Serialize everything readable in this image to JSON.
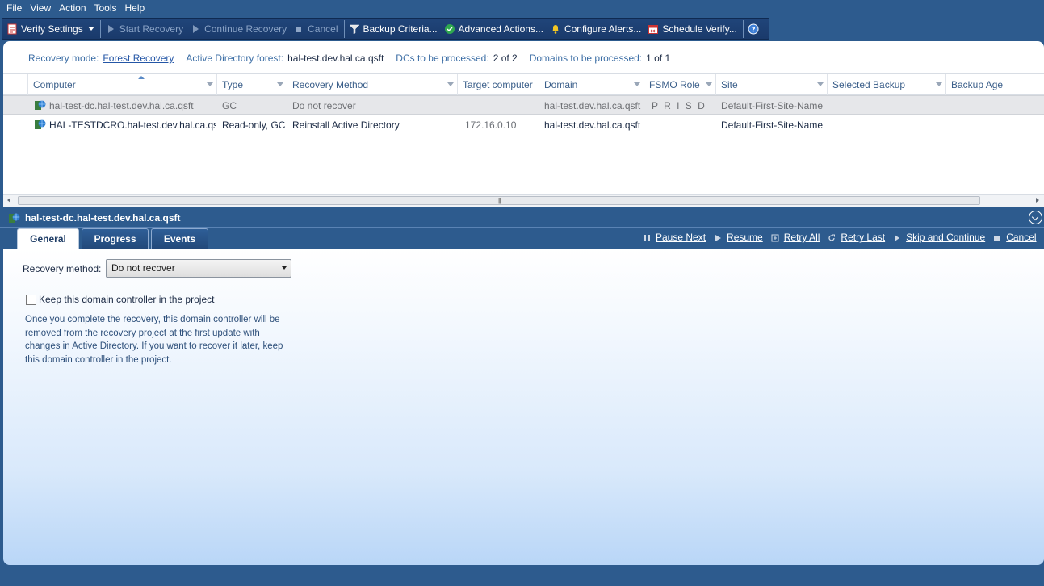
{
  "menu": [
    "File",
    "View",
    "Action",
    "Tools",
    "Help"
  ],
  "toolbar": {
    "verify_settings": "Verify Settings",
    "start_recovery": "Start Recovery",
    "continue_recovery": "Continue Recovery",
    "cancel": "Cancel",
    "backup_criteria": "Backup Criteria...",
    "advanced_actions": "Advanced Actions...",
    "configure_alerts": "Configure Alerts...",
    "schedule_verify": "Schedule Verify..."
  },
  "info": {
    "recovery_mode_label": "Recovery mode:",
    "recovery_mode_value": "Forest Recovery",
    "forest_label": "Active Directory forest:",
    "forest_value": "hal-test.dev.hal.ca.qsft",
    "dcs_label": "DCs to be processed:",
    "dcs_value": "2 of 2",
    "domains_label": "Domains to be processed:",
    "domains_value": "1 of 1"
  },
  "grid": {
    "columns": [
      "Computer",
      "Type",
      "Recovery Method",
      "Target computer",
      "Domain",
      "FSMO Role",
      "Site",
      "Selected Backup",
      "Backup Age"
    ],
    "rows": [
      {
        "computer": "hal-test-dc.hal-test.dev.hal.ca.qsft",
        "type": "GC",
        "recovery_method": "Do not recover",
        "target": "",
        "domain": "hal-test.dev.hal.ca.qsft",
        "fsmo": "P R I S D",
        "site": "Default-First-Site-Name",
        "backup": "",
        "age": ""
      },
      {
        "computer": "HAL-TESTDCRO.hal-test.dev.hal.ca.qsft",
        "type": "Read-only, GC",
        "recovery_method": "Reinstall Active Directory",
        "target": "172.16.0.10",
        "domain": "hal-test.dev.hal.ca.qsft",
        "fsmo": "",
        "site": "Default-First-Site-Name",
        "backup": "",
        "age": ""
      }
    ]
  },
  "details": {
    "title": "hal-test-dc.hal-test.dev.hal.ca.qsft",
    "tabs": [
      "General",
      "Progress",
      "Events"
    ],
    "actions": [
      "Pause Next",
      "Resume",
      "Retry All",
      "Retry Last",
      "Skip and Continue",
      "Cancel"
    ],
    "recovery_method_label": "Recovery method:",
    "recovery_method_value": "Do not recover",
    "keep_label": "Keep this domain controller in the project",
    "keep_note": "Once you complete the recovery, this domain controller will be removed from the recovery project at the first update with changes in Active Directory. If you want to recover it later, keep this domain controller in the project."
  },
  "colors": {
    "frame": "#2d5b8e",
    "toolbar": "#1a3a6b",
    "link": "#2456a6"
  }
}
